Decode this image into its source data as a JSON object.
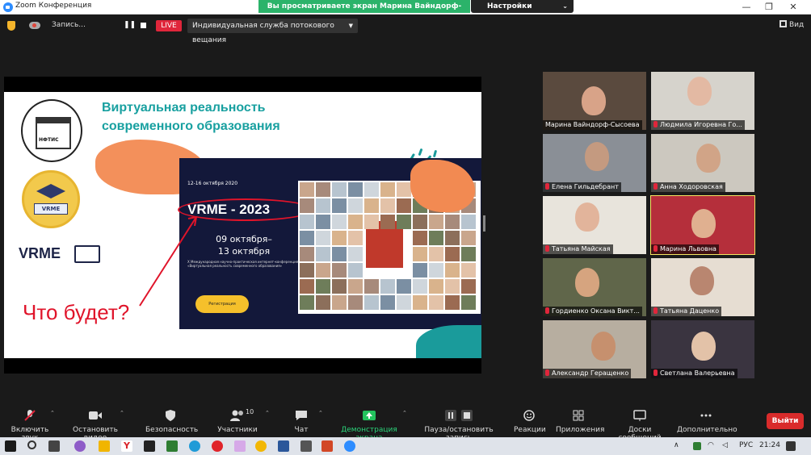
{
  "window": {
    "title": "Zoom Конференция",
    "share_banner": "Вы просматриваете экран Марина Вайндорф-Сысоева",
    "view_options": "Настройки просмотра"
  },
  "recording": {
    "label": "Запись...",
    "live": "LIVE",
    "stream_service": "Индивидуальная служба потокового вещания",
    "view": "Вид"
  },
  "slide": {
    "title": "Виртуальная реальность современного образования",
    "uni_logo_text": "НФТИС",
    "vrme_badge": "VRME",
    "vrme_logo": "VRME",
    "poster_date": "12-16 октября 2020",
    "poster_title": "VRME - 2023",
    "poster_dates": "09 октября–\n13 октября",
    "poster_desc": "X Международная научно-практическая интернет-конференция «Виртуальная реальность современного образования»",
    "register": "Регистрация",
    "question": "Что будет?"
  },
  "participants": [
    {
      "name": "Марина Вайндорф-Сысоева",
      "muted": false,
      "active": false,
      "bg": "#5a4a3e",
      "skin": "#d8a388"
    },
    {
      "name": "Людмила Игоревна Го...",
      "muted": true,
      "active": false,
      "bg": "#d6d3cc",
      "skin": "#e3b9a3"
    },
    {
      "name": "Елена Гильдебрант",
      "muted": true,
      "active": false,
      "bg": "#8a8f96",
      "skin": "#c49a80"
    },
    {
      "name": "Анна Ходоровская",
      "muted": true,
      "active": false,
      "bg": "#ccc8bf",
      "skin": "#d1a487"
    },
    {
      "name": "Татьяна Майская",
      "muted": true,
      "active": false,
      "bg": "#e8e4dc",
      "skin": "#e2b49b"
    },
    {
      "name": "Марина Львовна",
      "muted": true,
      "active": true,
      "bg": "#b52f3b",
      "skin": "#e0b090"
    },
    {
      "name": "Гордиенко Оксана Викт...",
      "muted": true,
      "active": false,
      "bg": "#60664a",
      "skin": "#d6a47f"
    },
    {
      "name": "Татьяна Даценко",
      "muted": true,
      "active": false,
      "bg": "#e6ddd2",
      "skin": "#b98670"
    },
    {
      "name": "Александр Геращенко",
      "muted": true,
      "active": false,
      "bg": "#b7aea0",
      "skin": "#c6906e"
    },
    {
      "name": "Светлана Валерьевна",
      "muted": true,
      "active": false,
      "bg": "#3a3440",
      "skin": "#e3c2a8"
    }
  ],
  "toolbar": {
    "mute": "Включить звук",
    "video": "Остановить видео",
    "security": "Безопасность",
    "participants": "Участники",
    "participants_count": "10",
    "chat": "Чат",
    "share": "Демонстрация экрана",
    "pause_rec": "Пауза/остановить запись",
    "reactions": "Реакции",
    "apps": "Приложения",
    "whiteboards": "Доски сообщений",
    "more": "Дополнительно",
    "leave": "Выйти"
  },
  "taskbar": {
    "lang": "РУС",
    "time": "21:24"
  },
  "colors": {
    "accent_green": "#2bb36a",
    "live_red": "#e0263b",
    "leave_red": "#d92b2b",
    "active_speaker": "#f5e663"
  }
}
